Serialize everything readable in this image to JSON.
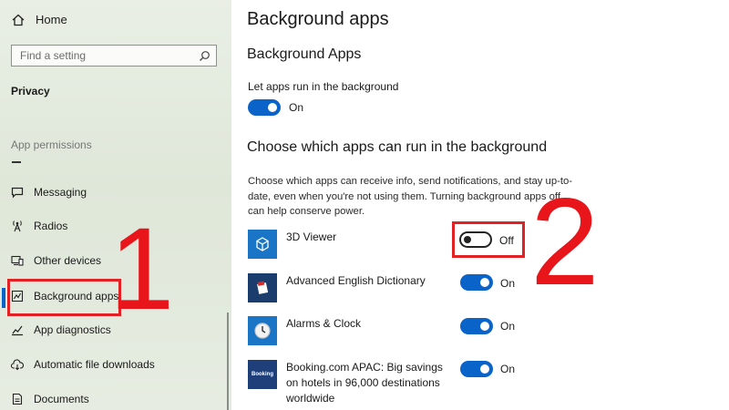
{
  "sidebar": {
    "home_label": "Home",
    "search_placeholder": "Find a setting",
    "section_title": "Privacy",
    "group_label": "App permissions",
    "items": [
      {
        "label": "Messaging",
        "icon": "messaging-icon"
      },
      {
        "label": "Radios",
        "icon": "radio-tower-icon"
      },
      {
        "label": "Other devices",
        "icon": "devices-icon"
      },
      {
        "label": "Background apps",
        "icon": "background-apps-icon",
        "selected": true
      },
      {
        "label": "App diagnostics",
        "icon": "diagnostics-icon"
      },
      {
        "label": "Automatic file downloads",
        "icon": "cloud-download-icon"
      },
      {
        "label": "Documents",
        "icon": "document-icon"
      }
    ]
  },
  "content": {
    "page_title": "Background apps",
    "sub_title": "Background Apps",
    "master_toggle": {
      "label": "Let apps run in the background",
      "state": "On"
    },
    "section_heading": "Choose which apps can run in the background",
    "description": "Choose which apps can receive info, send notifications, and stay up-to-date, even when you're not using them. Turning background apps off can help conserve power.",
    "apps": [
      {
        "name": "3D Viewer",
        "state": "Off",
        "icon": "cube-icon"
      },
      {
        "name": "Advanced English Dictionary",
        "state": "On",
        "icon": "dictionary-icon"
      },
      {
        "name": "Alarms & Clock",
        "state": "On",
        "icon": "clock-icon"
      },
      {
        "name": "Booking.com APAC: Big savings on hotels in 96,000 destinations worldwide",
        "state": "On",
        "icon": "booking-icon",
        "icon_text": "Booking"
      }
    ]
  },
  "annotations": {
    "marker_1": "1",
    "marker_2": "2"
  },
  "colors": {
    "accent": "#0a63c9",
    "annotation_red": "#e12124"
  }
}
